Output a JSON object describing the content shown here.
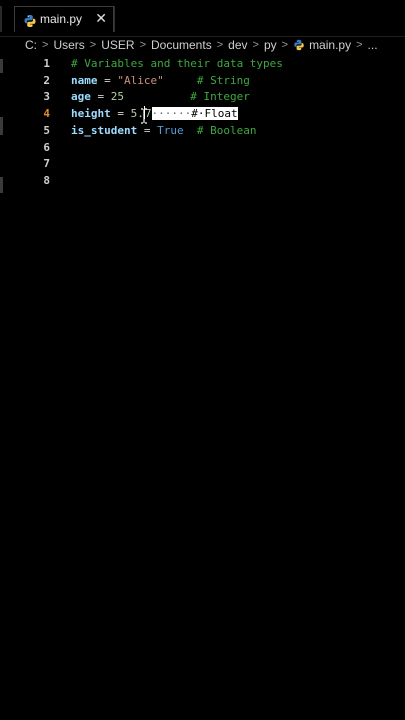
{
  "tab": {
    "label": "main.py",
    "close_glyph": "✕",
    "icon": "python-icon"
  },
  "breadcrumb": {
    "parts": [
      "C:",
      "Users",
      "USER",
      "Documents",
      "dev",
      "py"
    ],
    "separator": ">",
    "file": "main.py",
    "more": "...",
    "file_icon": "python-icon"
  },
  "editor": {
    "active_line": 4,
    "lines": [
      {
        "num": "1",
        "tokens": [
          {
            "t": "comment",
            "v": "# Variables and their data types"
          }
        ]
      },
      {
        "num": "2",
        "tokens": [
          {
            "t": "var",
            "v": "name"
          },
          {
            "t": "op",
            "v": " = "
          },
          {
            "t": "str",
            "v": "\"Alice\""
          },
          {
            "t": "plain",
            "v": "     "
          },
          {
            "t": "comment",
            "v": "# String"
          }
        ]
      },
      {
        "num": "3",
        "tokens": [
          {
            "t": "var",
            "v": "age"
          },
          {
            "t": "op",
            "v": " = "
          },
          {
            "t": "num",
            "v": "25"
          },
          {
            "t": "plain",
            "v": "          "
          },
          {
            "t": "comment",
            "v": "# Integer"
          }
        ]
      },
      {
        "num": "4",
        "tokens": [
          {
            "t": "var",
            "v": "height"
          },
          {
            "t": "op",
            "v": " = "
          },
          {
            "t": "num",
            "v": "5."
          },
          {
            "t": "num",
            "v": "7"
          },
          {
            "t": "seldots",
            "v": "······"
          },
          {
            "t": "sel",
            "v": "#·Float"
          }
        ]
      },
      {
        "num": "5",
        "tokens": [
          {
            "t": "var",
            "v": "is_student"
          },
          {
            "t": "op",
            "v": " = "
          },
          {
            "t": "kw",
            "v": "True"
          },
          {
            "t": "plain",
            "v": "  "
          },
          {
            "t": "comment",
            "v": "# Boolean"
          }
        ]
      },
      {
        "num": "6",
        "tokens": []
      },
      {
        "num": "7",
        "tokens": []
      },
      {
        "num": "8",
        "tokens": []
      }
    ]
  },
  "colors": {
    "background": "#000000",
    "comment": "#3fa83f",
    "variable": "#9cdcfe",
    "string": "#ce9178",
    "number": "#b5cea8",
    "keyword": "#569cd6",
    "active_line_number": "#e08a2c",
    "python_blue": "#3b7bbf",
    "python_yellow": "#f2c94c"
  }
}
